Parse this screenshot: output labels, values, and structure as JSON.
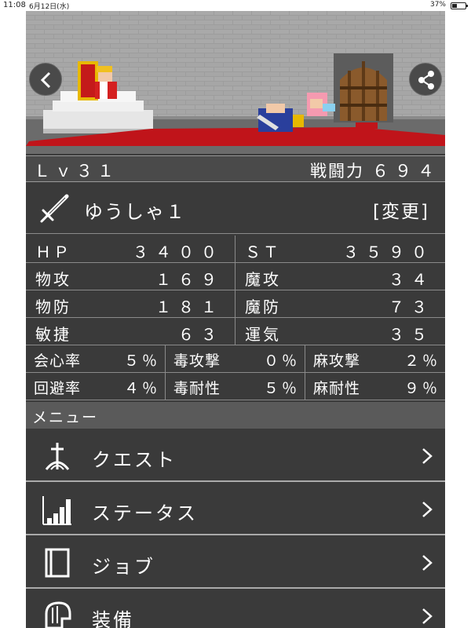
{
  "status_bar": {
    "time": "11:08",
    "date": "6月12日(水)",
    "battery": "37%",
    "battery_level": 0.37
  },
  "icons": {
    "back": "chevron-left-icon",
    "share": "share-icon",
    "sword": "sword-icon",
    "quest": "quest-icon",
    "status": "bar-chart-icon",
    "job": "book-icon",
    "equip": "helmet-icon",
    "chevron": "chevron-right-icon"
  },
  "colors": {
    "background": "#3a3a3a",
    "header": "#4a4a4a",
    "carpet": "#c0141a",
    "text": "#ffffff"
  },
  "character": {
    "level_label": "Ｌｖ３１",
    "power_label": "戦闘力",
    "power_value": "６９４",
    "name": "ゆうしゃ１",
    "change_label": "[変更]"
  },
  "stats": {
    "hp_label": "ＨＰ",
    "hp": "３４００",
    "st_label": "ＳＴ",
    "st": "３５９０",
    "patk_label": "物攻",
    "patk": "１６９",
    "matk_label": "魔攻",
    "matk": "３４",
    "pdef_label": "物防",
    "pdef": "１８１",
    "mdef_label": "魔防",
    "mdef": "７３",
    "agi_label": "敏捷",
    "agi": "６３",
    "luck_label": "運気",
    "luck": "３５",
    "crit_label": "会心率",
    "crit": "５％",
    "poison_atk_label": "毒攻撃",
    "poison_atk": "０％",
    "para_atk_label": "麻攻撃",
    "para_atk": "２％",
    "evade_label": "回避率",
    "evade": "４％",
    "poison_res_label": "毒耐性",
    "poison_res": "５％",
    "para_res_label": "麻耐性",
    "para_res": "９％"
  },
  "menu": {
    "header": "メニュー",
    "items": [
      {
        "label": "クエスト"
      },
      {
        "label": "ステータス"
      },
      {
        "label": "ジョブ"
      },
      {
        "label": "装備"
      }
    ]
  }
}
